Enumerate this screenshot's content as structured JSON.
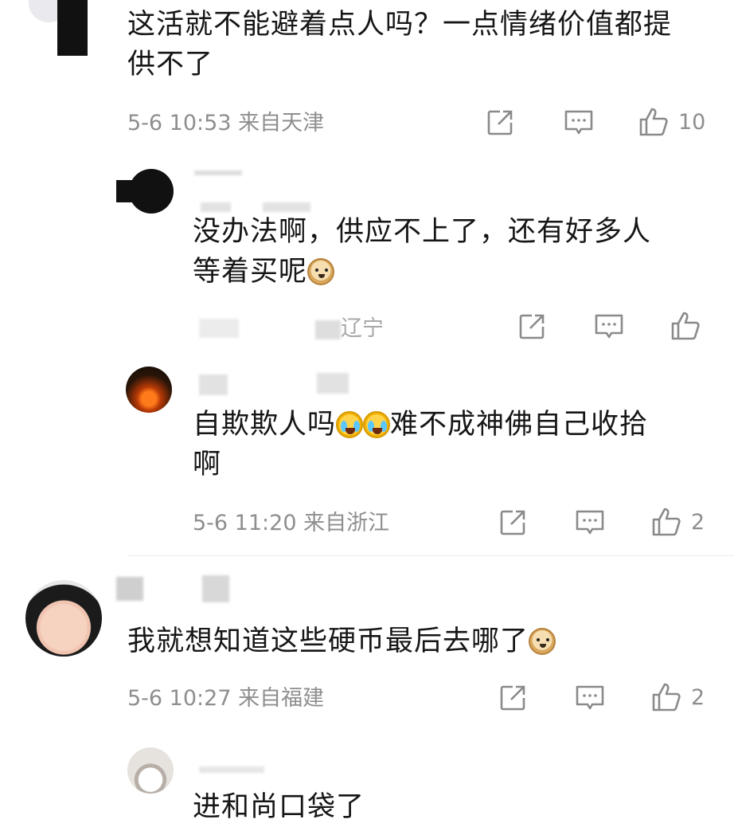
{
  "comments": [
    {
      "text_line1": "这活就不能避着点人吗？一点情绪价值都提",
      "text_line2": "供不了",
      "time": "5-6 10:53",
      "location": "来自天津",
      "likes": "10"
    },
    {
      "text_line1": "没办法啊，供应不上了，还有好多人",
      "text_line2": "等着买呢",
      "location_partial": "辽宁",
      "likes": ""
    },
    {
      "text_line1a": "自欺欺人吗",
      "text_line1b": "难不成神佛自己收拾",
      "text_line2": "啊",
      "time": "5-6 11:20",
      "location": "来自浙江",
      "likes": "2"
    },
    {
      "text_line1": "我就想知道这些硬币最后去哪了",
      "time": "5-6 10:27",
      "location": "来自福建",
      "likes": "2"
    },
    {
      "text_line1": "进和尚口袋了"
    }
  ],
  "icons": {
    "share": "share-icon",
    "comment": "comment-icon",
    "like": "thumbs-up-icon",
    "emoji_doge": "doge-emoji-icon",
    "emoji_cry": "laugh-cry-emoji-icon"
  }
}
